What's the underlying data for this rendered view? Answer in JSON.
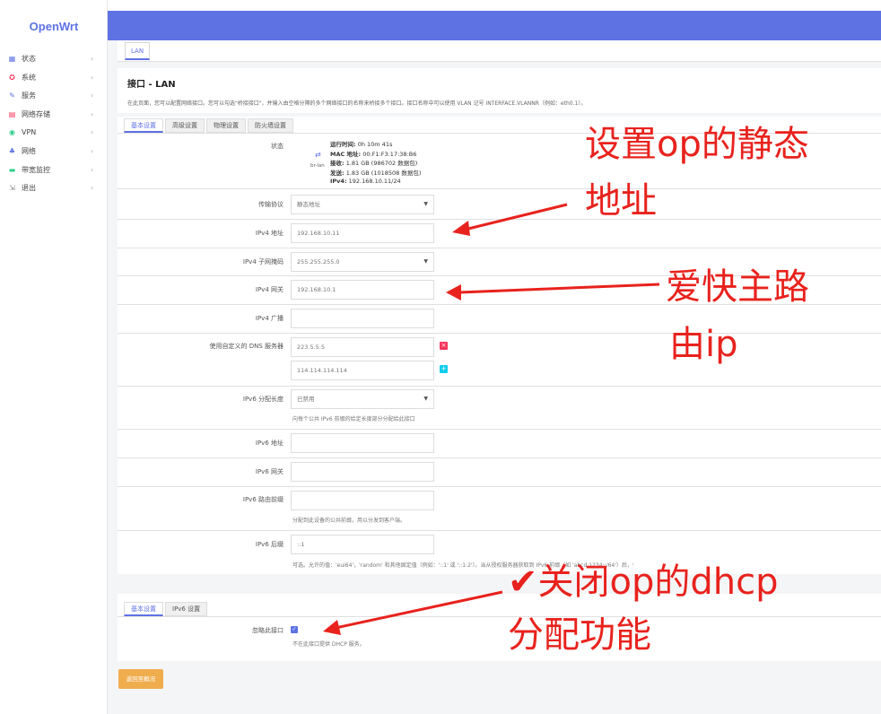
{
  "sidebar": {
    "logo": "OpenWrt",
    "items": [
      {
        "label": "状态",
        "icon": "dashboard-icon",
        "color": "#5e72e4"
      },
      {
        "label": "系统",
        "icon": "gear-icon",
        "color": "#f5365c"
      },
      {
        "label": "服务",
        "icon": "wrench-icon",
        "color": "#5e72e4"
      },
      {
        "label": "网络存储",
        "icon": "storage-icon",
        "color": "#f5365c"
      },
      {
        "label": "VPN",
        "icon": "shield-icon",
        "color": "#2dce89"
      },
      {
        "label": "网络",
        "icon": "network-icon",
        "color": "#5e72e4"
      },
      {
        "label": "带宽监控",
        "icon": "monitor-icon",
        "color": "#2dce89"
      },
      {
        "label": "退出",
        "icon": "logout-icon",
        "color": "#888888"
      }
    ]
  },
  "top_tab": "LAN",
  "page": {
    "title": "接口 - LAN",
    "description": "在此页面，您可以配置网络接口。您可以勾选\"桥接接口\"，并输入由空格分隔的多个网络接口的名称来桥接多个接口。接口名称中可以使用 VLAN 记号 INTERFACE.VLANNR（例如：eth0.1）。"
  },
  "general_tabs": [
    "基本设置",
    "高级设置",
    "物理设置",
    "防火墙设置"
  ],
  "status": {
    "label": "状态",
    "device": "br-lan",
    "uptime_label": "运行时间:",
    "uptime": "0h 10m 41s",
    "mac_label": "MAC 地址:",
    "mac": "00:F1:F3:17:38:B6",
    "rx_label": "接收:",
    "rx": "1.81 GB (986702 数据包)",
    "tx_label": "发送:",
    "tx": "1.83 GB (1018508 数据包)",
    "ipv4_label": "IPv4:",
    "ipv4": "192.168.10.11/24"
  },
  "fields": {
    "protocol": {
      "label": "传输协议",
      "value": "静态地址"
    },
    "ipv4_addr": {
      "label": "IPv4 地址",
      "value": "192.168.10.11"
    },
    "netmask": {
      "label": "IPv4 子网掩码",
      "value": "255.255.255.0"
    },
    "gateway": {
      "label": "IPv4 网关",
      "value": "192.168.10.1"
    },
    "broadcast": {
      "label": "IPv4 广播",
      "value": ""
    },
    "dns": {
      "label": "使用自定义的 DNS 服务器",
      "values": [
        "223.5.5.5",
        "114.114.114.114"
      ]
    },
    "ipv6_assign": {
      "label": "IPv6 分配长度",
      "value": "已禁用",
      "hint": "向每个公共 IPv6 前缀的给定长度部分分配给此接口"
    },
    "ipv6_addr": {
      "label": "IPv6 地址",
      "value": ""
    },
    "ipv6_gw": {
      "label": "IPv6 网关",
      "value": ""
    },
    "ipv6_prefix": {
      "label": "IPv6 路由前缀",
      "value": "",
      "hint": "分配到此设备的公共前缀，用以分发到客户端。"
    },
    "ipv6_suffix": {
      "label": "IPv6 后缀",
      "value": "::1",
      "hint": "可选。允许的值：'eui64'，'random' 和其他固定值（例如：'::1' 或 '::1:2'）。当从授权服务器获取到 IPv6 前缀（如 'abcd:1234::/64'）后，使用后缀（如 '::1'）合成 IPv6 地址（'abcd:1234::1'）分配给此接口。"
    }
  },
  "dhcp": {
    "tabs": [
      "基本设置",
      "IPv6 设置"
    ],
    "ignore_label": "忽略此接口",
    "ignore_checked": true,
    "hint": "不在此接口提供 DHCP 服务。"
  },
  "back_button": "返回至概况",
  "annotations": {
    "a1": "设置op的静态",
    "a2": "地址",
    "a3": "爱快主路",
    "a4": "由ip",
    "a5": "✔关闭op的dhcp",
    "a6": "分配功能"
  },
  "colors": {
    "accent": "#5e72e4",
    "annotation": "#e8221d",
    "back_button": "#f0ad4e"
  }
}
